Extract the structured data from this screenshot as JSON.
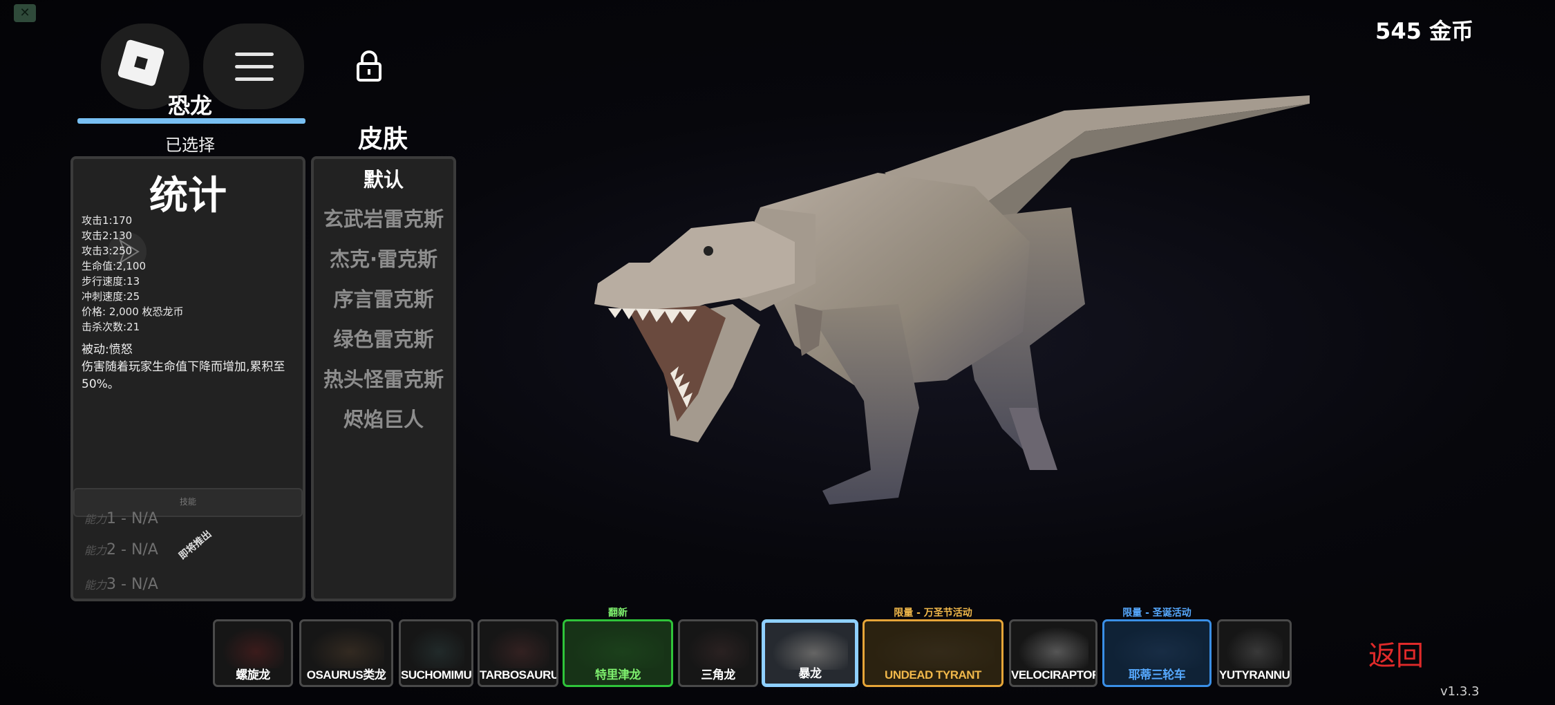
{
  "coins_text": "545 金币",
  "tabs": {
    "dinosaur": "恐龙",
    "selected": "已选择",
    "skins": "皮肤"
  },
  "stats": {
    "title": "统计",
    "lines": [
      "攻击1:170",
      "攻击2:130",
      "攻击3:250",
      "生命值:2,100",
      "步行速度:13",
      "冲刺速度:25",
      "价格: 2,000 枚恐龙币",
      "击杀次数:21"
    ],
    "passive_title": "被动:愤怒",
    "passive_desc": "伤害随着玩家生命值下降而增加,累积至50%。",
    "skill_header": "技能",
    "abilities": [
      {
        "prefix": "能力",
        "text": "1 - N/A"
      },
      {
        "prefix": "能力",
        "text": "2 - N/A"
      },
      {
        "prefix": "能力",
        "text": "3 - N/A"
      }
    ],
    "coming_soon": "即将推出"
  },
  "skins": [
    "默认",
    "玄武岩雷克斯",
    "杰克·雷克斯",
    "序言雷克斯",
    "绿色雷克斯",
    "热头怪雷克斯",
    "烬焰巨人"
  ],
  "roster": [
    {
      "name": "螺旋龙",
      "tag": "",
      "style": "default",
      "thumb_color": "#5a2020"
    },
    {
      "name": "OSAURUS类龙",
      "tag": "",
      "style": "default",
      "thumb_color": "#4a3a2a"
    },
    {
      "name": "SUCHOMIMUS",
      "tag": "",
      "style": "default",
      "thumb_color": "#2a3a3a"
    },
    {
      "name": "TARBOSAURUS",
      "tag": "",
      "style": "default",
      "thumb_color": "#4a2a2a"
    },
    {
      "name": "特里津龙",
      "tag": "翻新",
      "style": "green",
      "thumb_color": "#1f4a1f"
    },
    {
      "name": "三角龙",
      "tag": "",
      "style": "default",
      "thumb_color": "#3a2a2a"
    },
    {
      "name": "暴龙",
      "tag": "",
      "style": "selected",
      "thumb_color": "#9a9690"
    },
    {
      "name": "UNDEAD TYRANT",
      "tag": "限量 - 万圣节活动",
      "style": "gold",
      "thumb_color": "#3a3020"
    },
    {
      "name": "VELOCIRAPTOR",
      "tag": "",
      "style": "default",
      "thumb_color": "#8a8a8a"
    },
    {
      "name": "耶蒂三轮车",
      "tag": "限量 - 圣诞活动",
      "style": "blue",
      "thumb_color": "#1f3550"
    },
    {
      "name": "YUTYRANNUS",
      "tag": "",
      "style": "default",
      "thumb_color": "#555"
    }
  ],
  "colors": {
    "accent": "#78bff2",
    "back": "#e02a2a",
    "green": "#2fc43a",
    "gold": "#e6a538",
    "blue": "#3a8fe6"
  },
  "back_label": "返回",
  "version": "v1.3.3"
}
